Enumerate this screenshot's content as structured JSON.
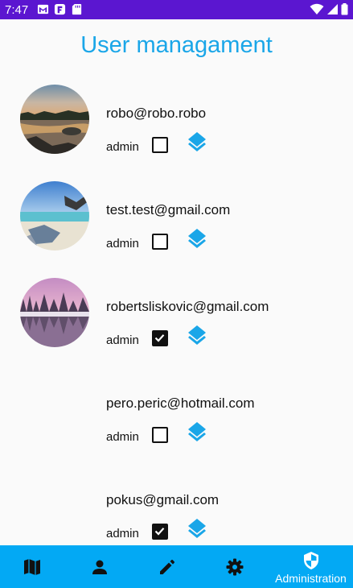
{
  "status_bar": {
    "time": "7:47",
    "icons_left": [
      "gmail-icon",
      "f-app-icon",
      "sd-card-icon"
    ],
    "icons_right": [
      "wifi-icon",
      "signal-icon",
      "battery-icon"
    ],
    "color": "#5b16d0"
  },
  "page": {
    "title": "User managament",
    "title_color": "#1aa6e8"
  },
  "users": [
    {
      "email": "robo@robo.robo",
      "admin_label": "admin",
      "admin": false,
      "avatar": "lake-sunset-photo"
    },
    {
      "email": "test.test@gmail.com",
      "admin_label": "admin",
      "admin": false,
      "avatar": "beach-photo"
    },
    {
      "email": "robertsliskovic@gmail.com",
      "admin_label": "admin",
      "admin": true,
      "avatar": "winter-forest-lake-photo"
    },
    {
      "email": "pero.peric@hotmail.com",
      "admin_label": "admin",
      "admin": false,
      "avatar": ""
    },
    {
      "email": "pokus@gmail.com",
      "admin_label": "admin",
      "admin": true,
      "avatar": ""
    }
  ],
  "bottom_nav": {
    "color": "#03a9f4",
    "items": [
      {
        "icon": "map-icon",
        "label": ""
      },
      {
        "icon": "person-icon",
        "label": ""
      },
      {
        "icon": "pencil-icon",
        "label": ""
      },
      {
        "icon": "gear-icon",
        "label": ""
      },
      {
        "icon": "shield-icon",
        "label": "Administration",
        "active": true
      }
    ]
  }
}
